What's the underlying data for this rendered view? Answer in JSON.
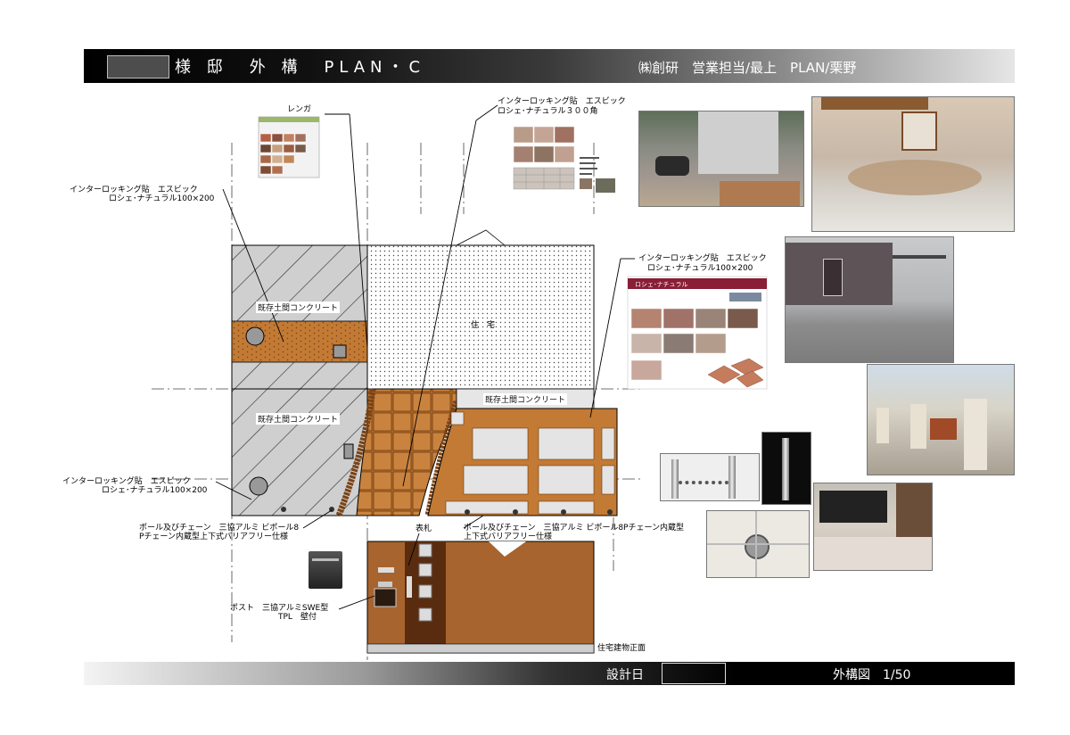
{
  "header": {
    "title": "様 邸　外 構　PLAN・C",
    "company": "㈱創研　営業担当/最上　PLAN/栗野"
  },
  "footer": {
    "design_date_label": "設計日",
    "sheet_label": "外構図　1/50"
  },
  "labels": {
    "renga": "レンガ",
    "interlocking_top_1": "インターロッキング貼　エスビック",
    "interlocking_top_2": "ロシェ･ナチュラル３００角",
    "interlocking_left_1": "インターロッキング貼　エスビック",
    "interlocking_left_2": "ロシェ･ナチュラル100×200",
    "interlocking_right_1": "インターロッキング貼　エスビック",
    "interlocking_right_2": "ロシェ･ナチュラル100×200",
    "interlocking_low_1": "インターロッキング貼　エスビック",
    "interlocking_low_2": "ロシェ･ナチュラル100×200",
    "concrete_1": "既存土間コンクリート",
    "concrete_2": "既存土間コンクリート",
    "concrete_3": "既存土間コンクリート",
    "house": "住　宅",
    "pole_left_1": "ポール及びチェーン　三協アルミ ビポール8",
    "pole_left_2": "Pチェーン内蔵型上下式バリアフリー仕様",
    "pole_right_1": "ポール及びチェーン　三協アルミ ビポール8Pチェーン内蔵型",
    "pole_right_2": "上下式バリアフリー仕様",
    "nameplate": "表札",
    "post_1": "ポスト　三協アルミSWE型",
    "post_2": "TPL　壁付",
    "elevation": "住宅建物正面",
    "catalog_title": "ロシェ･ナチュラル"
  },
  "colors": {
    "brick": "#b8783a",
    "wall_brown": "#a8642e",
    "hatch": "#c8c8c8",
    "concrete": "#d9d9d9"
  }
}
